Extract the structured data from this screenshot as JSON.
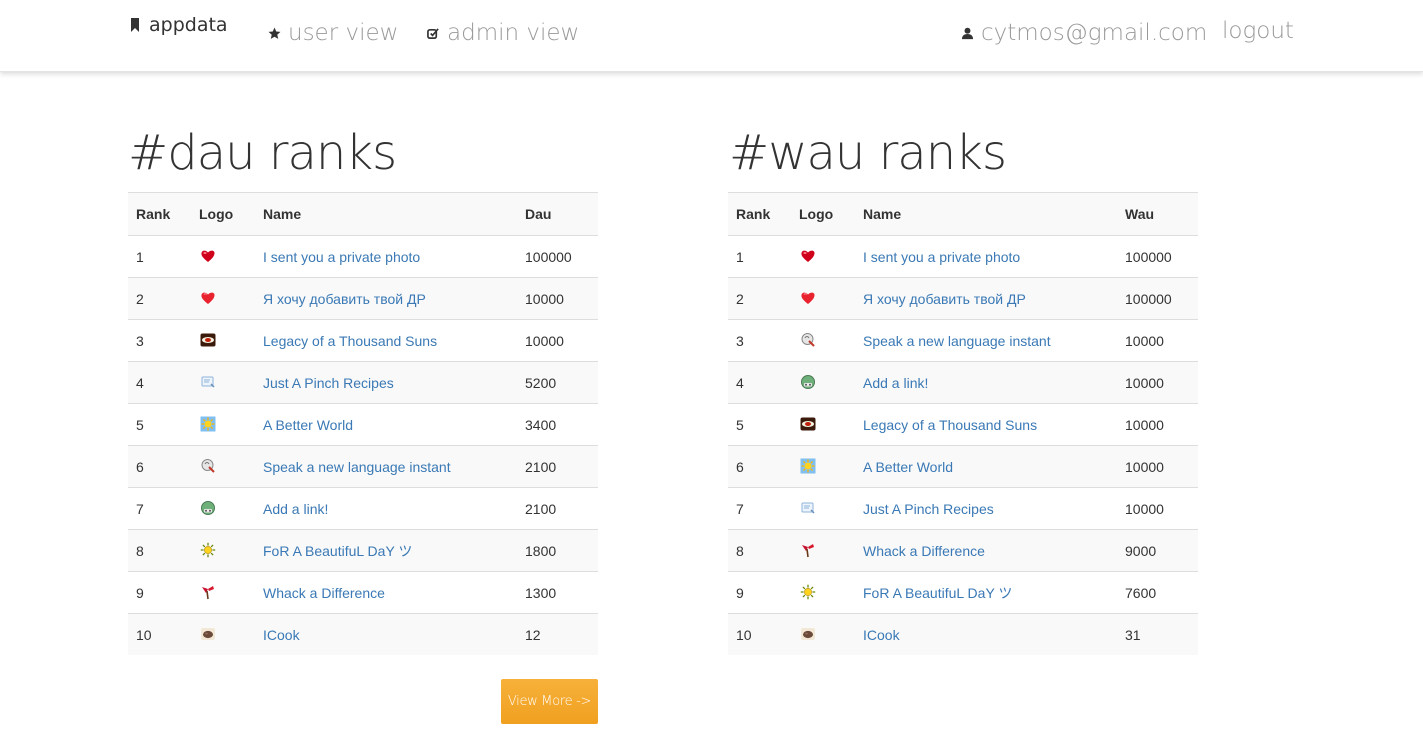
{
  "nav": {
    "brand": "appdata",
    "user_view": "user view",
    "admin_view": "admin view",
    "email": "cytmos@gmail.com",
    "logout": "logout",
    "icons": {
      "brand": "bookmark-icon",
      "user_view": "star-icon",
      "admin_view": "edit-checkbox-icon",
      "email": "user-icon"
    }
  },
  "colors": {
    "link": "#3a79b5",
    "button": "#f5a623",
    "stripe": "#f9f9f9"
  },
  "dau": {
    "title": "#dau ranks",
    "headers": [
      "Rank",
      "Logo",
      "Name",
      "Dau"
    ],
    "rows": [
      {
        "rank": "1",
        "logo": "red-heart-icon",
        "name": "I sent you a private photo",
        "value": "100000"
      },
      {
        "rank": "2",
        "logo": "heart-icon",
        "name": "Я хочу добавить твой ДР",
        "value": "10000"
      },
      {
        "rank": "3",
        "logo": "dark-eye-icon",
        "name": "Legacy of a Thousand Suns",
        "value": "10000"
      },
      {
        "rank": "4",
        "logo": "recipe-card-icon",
        "name": "Just A Pinch Recipes",
        "value": "5200"
      },
      {
        "rank": "5",
        "logo": "sun-tile-icon",
        "name": "A Better World",
        "value": "3400"
      },
      {
        "rank": "6",
        "logo": "speech-bubble-icon",
        "name": "Speak a new language instant",
        "value": "2100"
      },
      {
        "rank": "7",
        "logo": "link-globe-icon",
        "name": "Add a link!",
        "value": "2100"
      },
      {
        "rank": "8",
        "logo": "sun-icon",
        "name": "FoR A BeautifuL DaY ツ",
        "value": "1800"
      },
      {
        "rank": "9",
        "logo": "mallet-icon",
        "name": "Whack a Difference",
        "value": "1300"
      },
      {
        "rank": "10",
        "logo": "cook-icon",
        "name": "ICook",
        "value": "12"
      }
    ]
  },
  "wau": {
    "title": "#wau ranks",
    "headers": [
      "Rank",
      "Logo",
      "Name",
      "Wau"
    ],
    "rows": [
      {
        "rank": "1",
        "logo": "red-heart-icon",
        "name": "I sent you a private photo",
        "value": "100000"
      },
      {
        "rank": "2",
        "logo": "heart-icon",
        "name": "Я хочу добавить твой ДР",
        "value": "100000"
      },
      {
        "rank": "3",
        "logo": "speech-bubble-icon",
        "name": "Speak a new language instant",
        "value": "10000"
      },
      {
        "rank": "4",
        "logo": "link-globe-icon",
        "name": "Add a link!",
        "value": "10000"
      },
      {
        "rank": "5",
        "logo": "dark-eye-icon",
        "name": "Legacy of a Thousand Suns",
        "value": "10000"
      },
      {
        "rank": "6",
        "logo": "sun-tile-icon",
        "name": "A Better World",
        "value": "10000"
      },
      {
        "rank": "7",
        "logo": "recipe-card-icon",
        "name": "Just A Pinch Recipes",
        "value": "10000"
      },
      {
        "rank": "8",
        "logo": "mallet-icon",
        "name": "Whack a Difference",
        "value": "9000"
      },
      {
        "rank": "9",
        "logo": "sun-icon",
        "name": "FoR A BeautifuL DaY ツ",
        "value": "7600"
      },
      {
        "rank": "10",
        "logo": "cook-icon",
        "name": "ICook",
        "value": "31"
      }
    ]
  },
  "view_more": "View More ->"
}
